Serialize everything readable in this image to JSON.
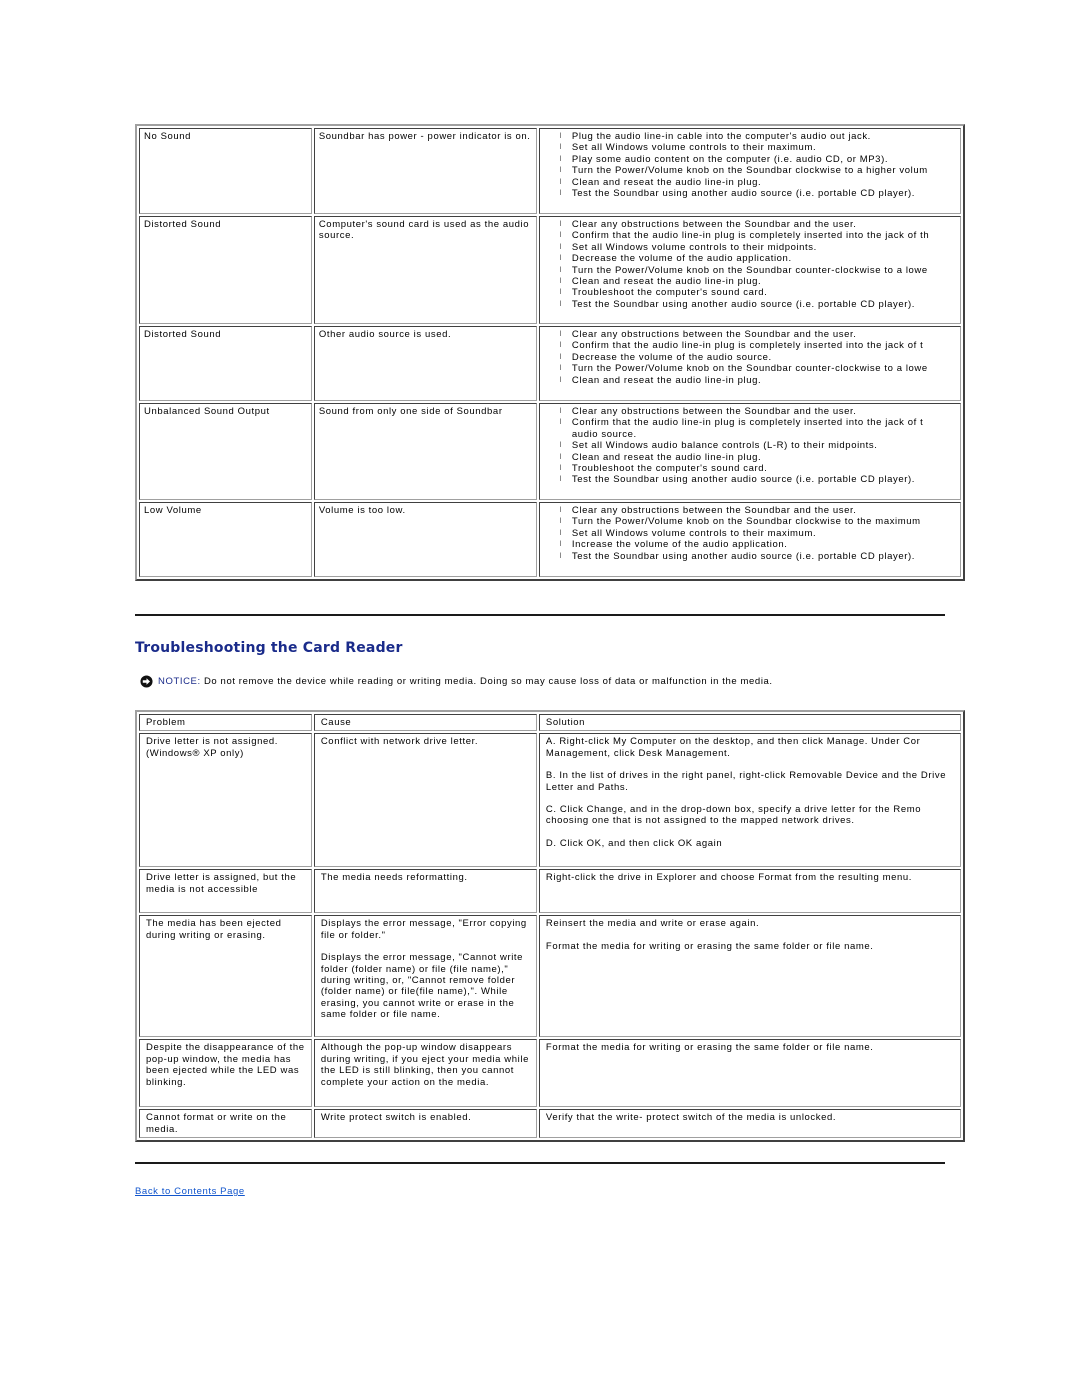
{
  "soundbar_table": {
    "rows": [
      {
        "problem": "No Sound",
        "cause": "Soundbar has power - power indicator is on.",
        "solutions": [
          "Plug the audio line-in cable into the computer's audio out jack.",
          "Set all Windows volume controls to their maximum.",
          "Play some audio content on the computer (i.e. audio CD, or MP3).",
          "Turn the Power/Volume knob on the Soundbar clockwise to a higher volum",
          "Clean and reseat the audio line-in plug.",
          "Test the Soundbar using another audio source (i.e. portable CD player)."
        ]
      },
      {
        "problem": "Distorted Sound",
        "cause": "Computer's sound card is used as the audio source.",
        "solutions": [
          "Clear any obstructions between the Soundbar and the user.",
          "Confirm that the audio line-in plug is completely inserted into the jack of th",
          "Set all Windows volume controls to their midpoints.",
          "Decrease the volume of the audio application.",
          "Turn the Power/Volume knob on the Soundbar counter-clockwise to a lowe",
          "Clean and reseat the audio line-in plug.",
          "Troubleshoot the computer's sound card.",
          "Test the Soundbar using another audio source (i.e. portable CD player)."
        ]
      },
      {
        "problem": "Distorted Sound",
        "cause": "Other audio source is used.",
        "solutions": [
          "Clear any obstructions between the Soundbar and the user.",
          "Confirm that the audio line-in plug is completely inserted into the jack of t",
          "Decrease the volume of the audio source.",
          "Turn the Power/Volume knob on the Soundbar counter-clockwise to a lowe",
          "Clean and reseat the audio line-in plug."
        ]
      },
      {
        "problem": "Unbalanced Sound Output",
        "cause": "Sound from only one side of Soundbar",
        "solutions": [
          "Clear any obstructions between the Soundbar and the user.",
          "Confirm that the audio line-in plug is completely inserted into the jack of t\naudio source.",
          "Set all Windows audio balance controls (L-R) to their midpoints.",
          "Clean and reseat the audio line-in plug.",
          "Troubleshoot the computer's sound card.",
          "Test the Soundbar using another audio source (i.e. portable CD player)."
        ]
      },
      {
        "problem": "Low Volume",
        "cause": "Volume is too low.",
        "solutions": [
          "Clear any obstructions between the Soundbar and the user.",
          "Turn the Power/Volume knob on the Soundbar clockwise to the maximum",
          "Set all Windows volume controls to their maximum.",
          "Increase the volume of the audio application.",
          "Test the Soundbar using another audio source (i.e. portable CD player)."
        ]
      }
    ]
  },
  "card_reader": {
    "heading": "Troubleshooting the Card Reader",
    "notice_label": "NOTICE:",
    "notice_text": " Do not remove the device while reading or writing media. Doing so may cause loss of data or malfunction in the media.",
    "notice_icon": "arrow-right-circle-icon",
    "headers": [
      "Problem",
      "Cause",
      "Solution"
    ],
    "rows": [
      {
        "problem": "Drive letter is not assigned. (Windows® XP only)",
        "cause": [
          "Conflict with network drive letter."
        ],
        "solution": [
          "A. Right-click My Computer on the desktop, and then click Manage. Under Cor Management, click Desk Management.",
          "B. In the list of drives in the right panel, right-click Removable Device and the Drive Letter and Paths.",
          "C. Click Change, and in the drop-down box, specify a drive letter for the Remo choosing one that is not assigned to the mapped network drives.",
          "D. Click OK, and then click OK again"
        ]
      },
      {
        "problem": "Drive letter is assigned, but the media is not accessible",
        "cause": [
          "The media needs reformatting."
        ],
        "solution": [
          "Right-click the drive in Explorer and choose Format from the resulting menu."
        ]
      },
      {
        "problem": "The media has been ejected during writing or erasing.",
        "cause": [
          "Displays the error message, \"Error copying file or folder.\"",
          "Displays the error message, \"Cannot write folder (folder name) or file (file name),\" during writing, or, \"Cannot remove folder (folder name) or file(file name),\". While erasing, you cannot write or erase in the same folder or file name."
        ],
        "solution": [
          "Reinsert the media and write or erase again.",
          "Format the media for writing or erasing the same folder or file name."
        ]
      },
      {
        "problem": "Despite the disappearance of the pop-up window, the media has been ejected while the LED was blinking.",
        "cause": [
          "Although the pop-up window disappears during writing, if you eject your media while the LED is still blinking, then you cannot complete your action on the media."
        ],
        "solution": [
          "Format the media for writing or erasing the same folder or file name."
        ]
      },
      {
        "problem": "Cannot format or write on the media.",
        "cause": [
          "Write protect switch is enabled."
        ],
        "solution": [
          "Verify that the write- protect switch of the media is unlocked."
        ]
      }
    ]
  },
  "footer": {
    "back_link": "Back to Contents Page"
  }
}
